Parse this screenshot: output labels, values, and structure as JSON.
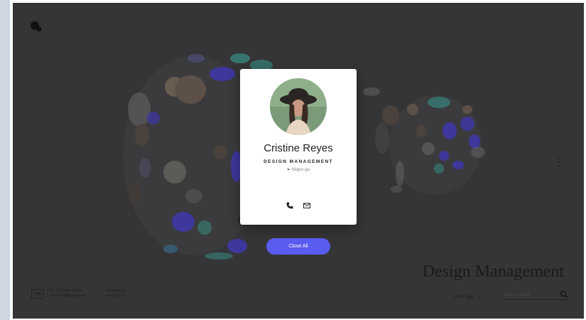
{
  "app": {
    "logo_icon": "logo-icon"
  },
  "profile": {
    "name": "Cristine Reyes",
    "role": "DESIGN MANAGEMENT",
    "location": "Mapo-gu",
    "location_icon": "location-arrow-icon",
    "phone_icon": "phone-icon",
    "mail_icon": "mail-icon"
  },
  "actions": {
    "close_all_label": "Close All"
  },
  "headline": "Design Management",
  "footer": {
    "logo_text": "IPMI",
    "copyright_line1": "2022 © Design by Tan",
    "copyright_line2": "E.seoulminji@gmail.com",
    "developed_line1": "Developed by",
    "developed_line2": "www.bom.kid"
  },
  "filter": {
    "circle_type_label": "Circle type",
    "chevron_icon": "chevron-down-icon"
  },
  "search": {
    "placeholder": "Search name",
    "icon": "search-icon"
  },
  "colors": {
    "accent": "#5a5bf0",
    "dot_purple": "#4b3fd9",
    "teal": "#3fb7a7",
    "backdrop": "#3d3d3f"
  }
}
